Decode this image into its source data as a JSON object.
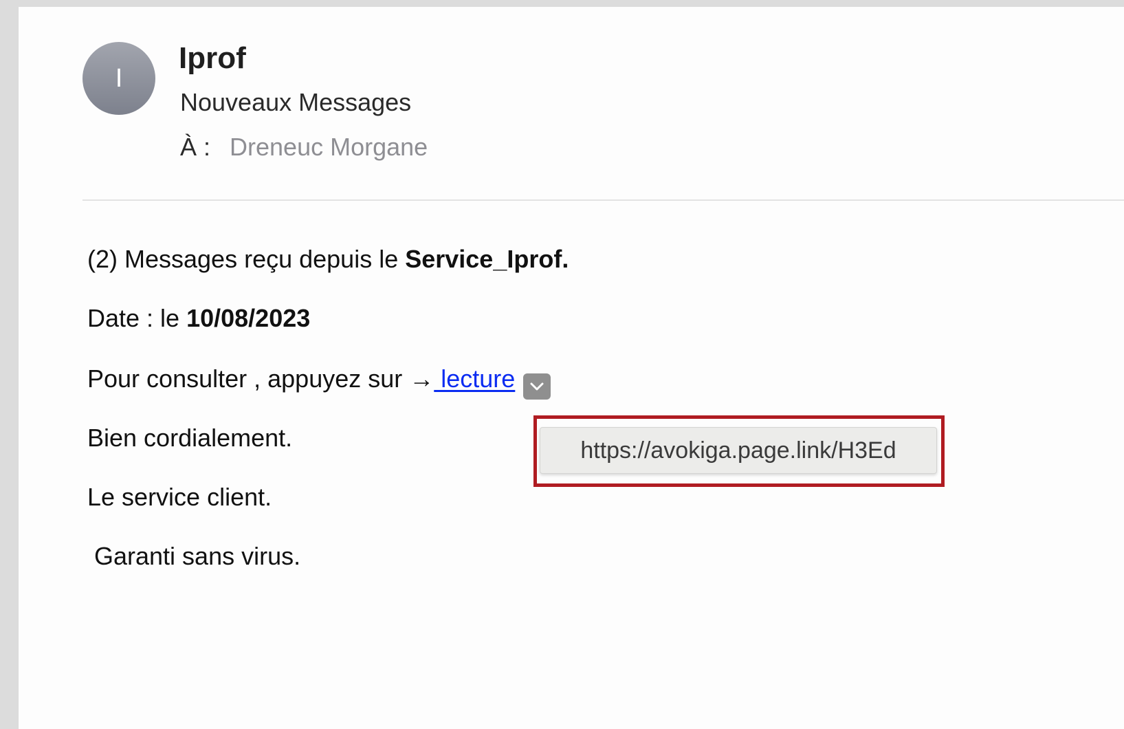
{
  "header": {
    "avatar_initial": "I",
    "sender": "Iprof",
    "subject": "Nouveaux Messages",
    "to_label": "À :",
    "to_value": "Dreneuc Morgane"
  },
  "body": {
    "line1_prefix": "(2) Messages reçu depuis le ",
    "line1_bold": "Service_Iprof.",
    "line2_prefix": "Date : le ",
    "line2_bold": "10/08/2023",
    "line3_prefix": "Pour consulter , appuyez sur ",
    "line3_arrow": "→",
    "line3_link": " lecture",
    "line4": "Bien cordialement.",
    "line5": "Le service client.",
    "line6": "Garanti sans virus."
  },
  "tooltip": {
    "url": "https://avokiga.page.link/H3Ed"
  },
  "colors": {
    "link": "#0b2cf2",
    "highlight_border": "#b01c22"
  }
}
